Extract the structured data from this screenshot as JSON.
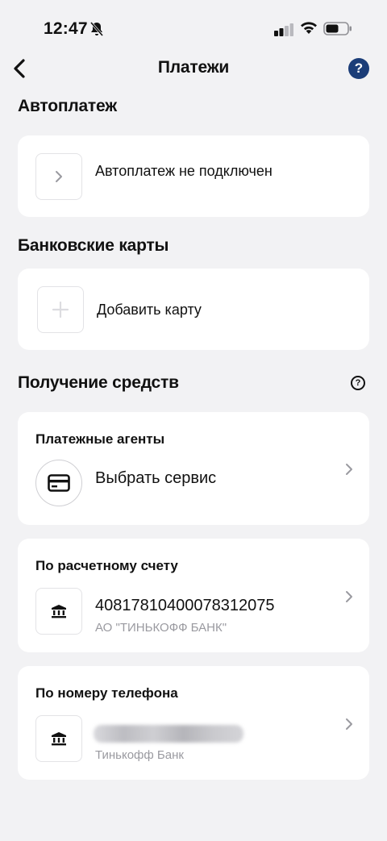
{
  "status_bar": {
    "time": "12:47",
    "icons": [
      "bell-off-icon",
      "signal-icon",
      "wifi-icon",
      "battery-icon"
    ]
  },
  "nav": {
    "back_icon": "chevron-left-icon",
    "title": "Платежи",
    "help_label": "?"
  },
  "autopay": {
    "section_title": "Автоплатеж",
    "label": "Автоплатеж не подключен"
  },
  "cards": {
    "section_title": "Банковские карты",
    "add_label": "Добавить карту"
  },
  "receiving": {
    "section_title": "Получение средств",
    "help_label": "?",
    "agents": {
      "header": "Платежные агенты",
      "label": "Выбрать сервис"
    },
    "account": {
      "header": "По расчетному счету",
      "number": "40817810400078312075",
      "bank": "АО \"ТИНЬКОФФ БАНК\""
    },
    "phone": {
      "header": "По номеру телефона",
      "bank": "Тинькофф Банк"
    }
  },
  "colors": {
    "background": "#f2f2f4",
    "card": "#ffffff",
    "accent": "#1b3d78",
    "muted": "#9a9aa0"
  }
}
